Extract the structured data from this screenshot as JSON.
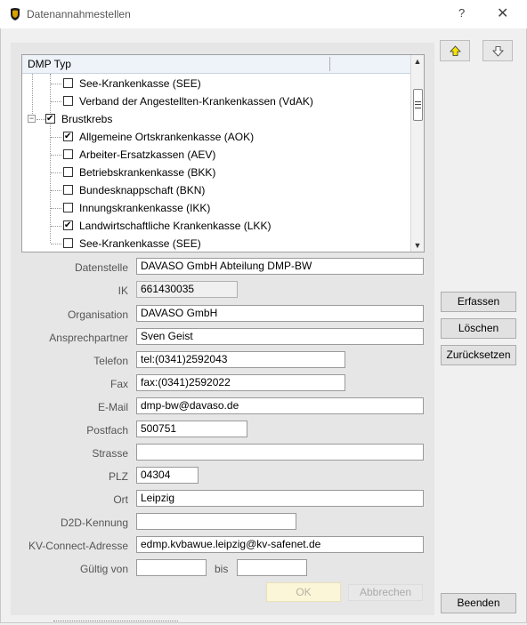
{
  "window": {
    "title": "Datenannahmestellen",
    "help": "?",
    "close": "✕"
  },
  "tree": {
    "header": "DMP Typ",
    "rows": [
      {
        "label": "See-Krankenkasse (SEE)",
        "checked": false
      },
      {
        "label": "Verband der Angestellten-Krankenkassen (VdAK)",
        "checked": false
      },
      {
        "label": "Brustkrebs",
        "checked": true,
        "expander": "−"
      },
      {
        "label": "Allgemeine Ortskrankenkasse (AOK)",
        "checked": true
      },
      {
        "label": "Arbeiter-Ersatzkassen (AEV)",
        "checked": false
      },
      {
        "label": "Betriebskrankenkasse (BKK)",
        "checked": false
      },
      {
        "label": "Bundesknappschaft (BKN)",
        "checked": false
      },
      {
        "label": "Innungskrankenkasse (IKK)",
        "checked": false
      },
      {
        "label": "Landwirtschaftliche Krankenkasse (LKK)",
        "checked": true
      },
      {
        "label": "See-Krankenkasse (SEE)",
        "checked": false
      }
    ]
  },
  "form": {
    "datenstelle": {
      "label": "Datenstelle",
      "value": "DAVASO GmbH Abteilung DMP-BW"
    },
    "ik": {
      "label": "IK",
      "value": "661430035"
    },
    "organisation": {
      "label": "Organisation",
      "value": "DAVASO GmbH"
    },
    "ansprechpartner": {
      "label": "Ansprechpartner",
      "value": "Sven Geist"
    },
    "telefon": {
      "label": "Telefon",
      "value": "tel:(0341)2592043"
    },
    "fax": {
      "label": "Fax",
      "value": "fax:(0341)2592022"
    },
    "email": {
      "label": "E-Mail",
      "value": "dmp-bw@davaso.de"
    },
    "postfach": {
      "label": "Postfach",
      "value": "500751"
    },
    "strasse": {
      "label": "Strasse",
      "value": ""
    },
    "plz": {
      "label": "PLZ",
      "value": "04304"
    },
    "ort": {
      "label": "Ort",
      "value": "Leipzig"
    },
    "d2d": {
      "label": "D2D-Kennung",
      "value": ""
    },
    "kvconnect": {
      "label": "KV-Connect-Adresse",
      "value": "edmp.kvbawue.leipzig@kv-safenet.de"
    },
    "gueltig_von": {
      "label": "Gültig von",
      "value": ""
    },
    "bis": {
      "label": "bis",
      "value": ""
    }
  },
  "buttons": {
    "ok": "OK",
    "abbrechen": "Abbrechen",
    "erfassen": "Erfassen",
    "loeschen": "Löschen",
    "zuruecksetzen": "Zurücksetzen",
    "beenden": "Beenden"
  },
  "colors": {
    "up_arrow": "#f5e400",
    "ok_disabled_bg": "#fcf6d8"
  }
}
